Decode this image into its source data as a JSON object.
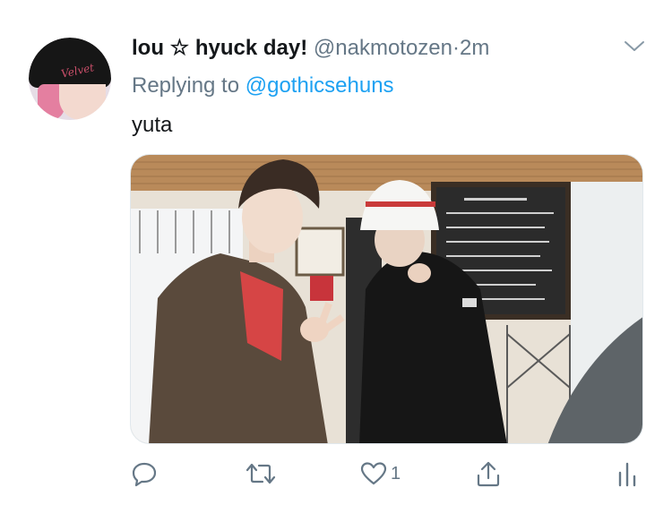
{
  "tweet": {
    "display_name": "lou ☆ hyuck day!",
    "handle": "@nakmotozen",
    "separator": "·",
    "time": "2m",
    "reply_prefix": "Replying to",
    "reply_target": "@gothicsehuns",
    "text": "yuta",
    "avatar_text": "Velvet"
  },
  "actions": {
    "reply_icon": "reply-icon",
    "retweet_icon": "retweet-icon",
    "like_icon": "heart-icon",
    "like_count": "1",
    "share_icon": "share-icon",
    "analytics_icon": "analytics-icon"
  },
  "colors": {
    "text": "#14171a",
    "secondary": "#657786",
    "link": "#1da1f2",
    "border": "#e1e8ed"
  }
}
